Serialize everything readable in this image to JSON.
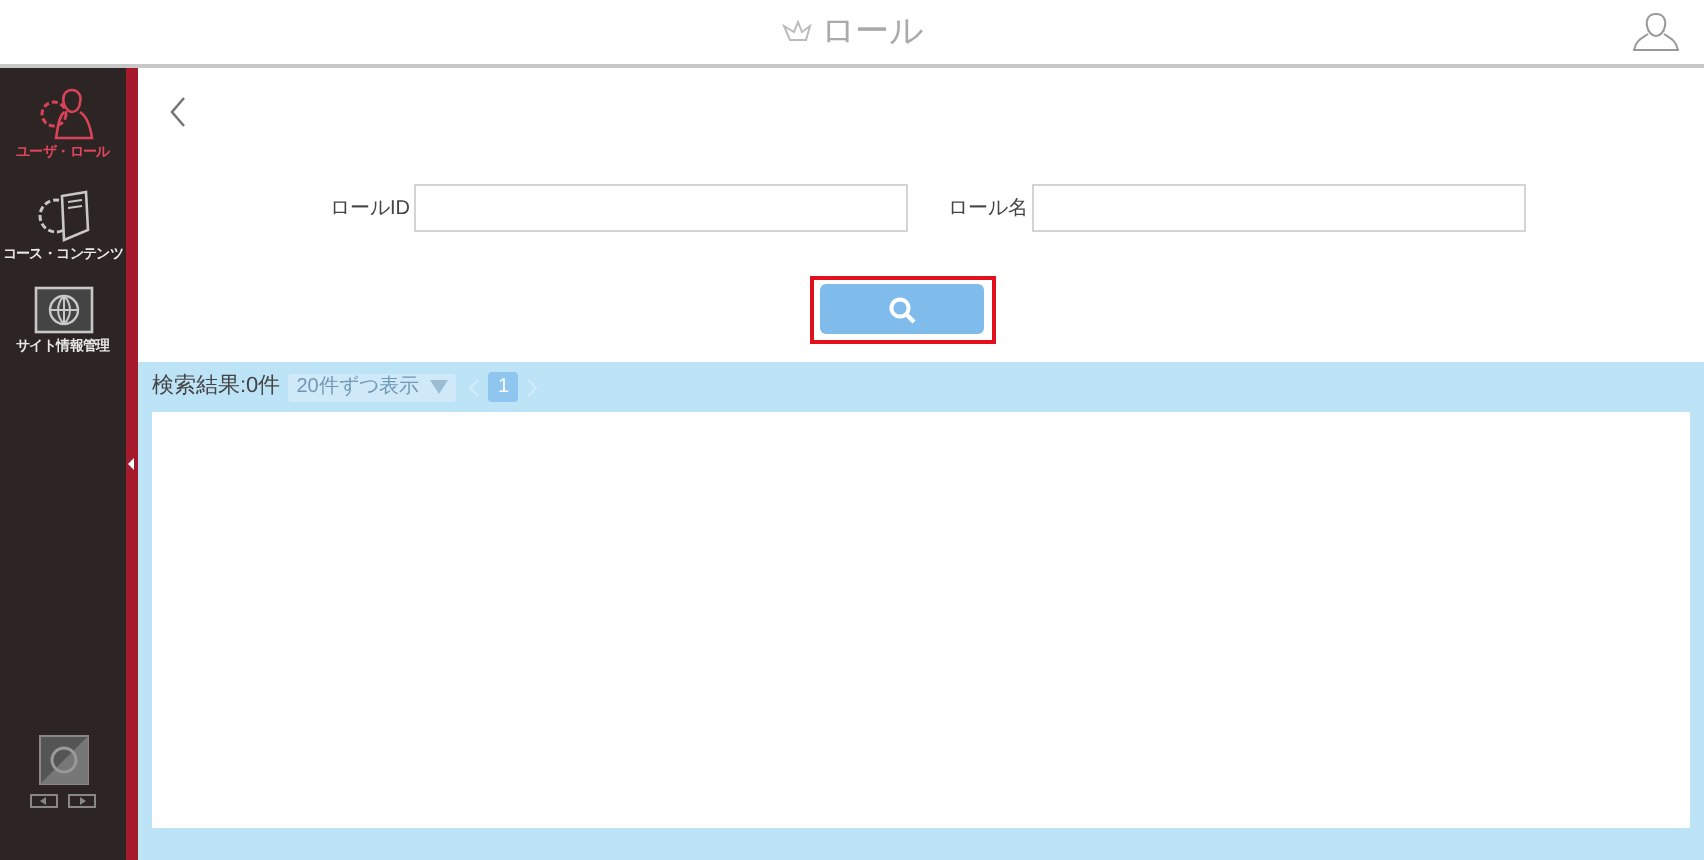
{
  "header": {
    "title": "ロール"
  },
  "sidebar": {
    "items": [
      {
        "label": "ユーザ・ロール",
        "kind": "users",
        "selected": true
      },
      {
        "label": "コース・コンテンツ",
        "kind": "course",
        "selected": false
      },
      {
        "label": "サイト情報管理",
        "kind": "site",
        "selected": false
      }
    ]
  },
  "form": {
    "fields": [
      {
        "label": "ロールID"
      },
      {
        "label": "ロール名"
      }
    ],
    "search_button": {
      "highlighted": true
    }
  },
  "results": {
    "count": "検索結果:0件",
    "per_page": "20件ずつ表示",
    "pages": [
      {
        "label": "1",
        "selected": true
      }
    ]
  }
}
